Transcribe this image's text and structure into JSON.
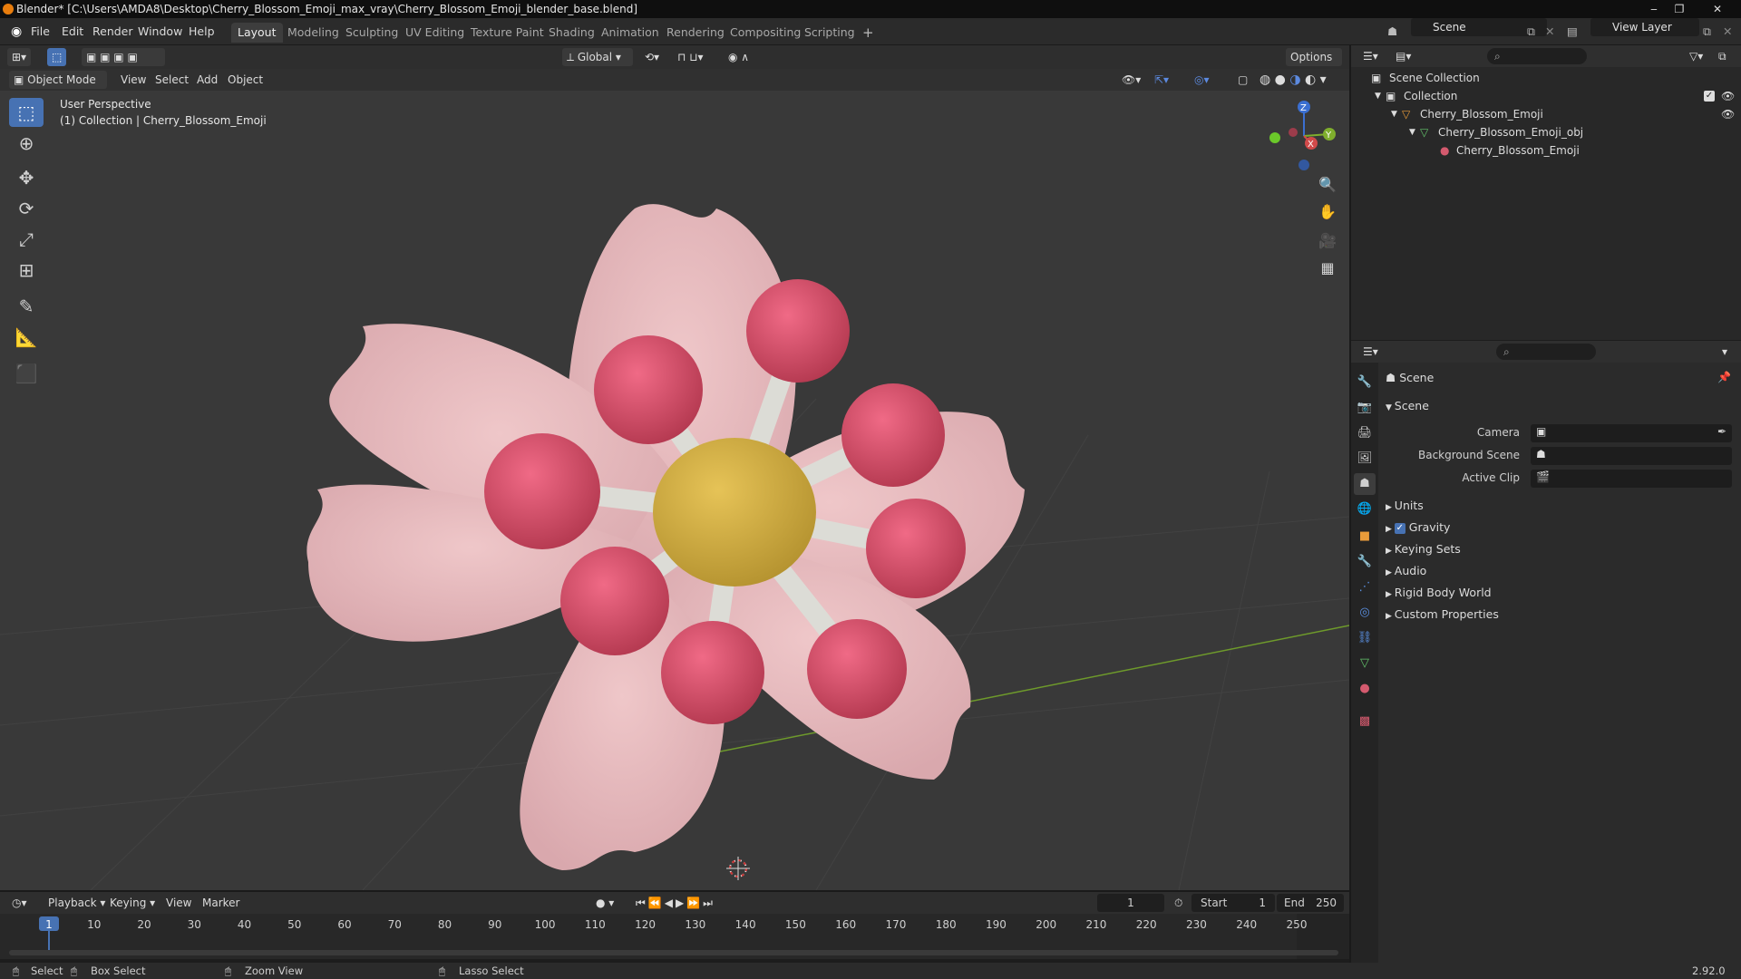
{
  "window": {
    "title": "Blender* [C:\\Users\\AMDA8\\Desktop\\Cherry_Blossom_Emoji_max_vray\\Cherry_Blossom_Emoji_blender_base.blend]",
    "minimize": "‒",
    "maximize": "❐",
    "close": "✕"
  },
  "menu": {
    "file": "File",
    "edit": "Edit",
    "render": "Render",
    "window": "Window",
    "help": "Help"
  },
  "workspaces": [
    "Layout",
    "Modeling",
    "Sculpting",
    "UV Editing",
    "Texture Paint",
    "Shading",
    "Animation",
    "Rendering",
    "Compositing",
    "Scripting"
  ],
  "topright": {
    "scene": "Scene",
    "view_layer": "View Layer"
  },
  "header": {
    "orientation": "Global",
    "options": "Options"
  },
  "viewport_menu": {
    "mode": "Object Mode",
    "view": "View",
    "select": "Select",
    "add": "Add",
    "object": "Object"
  },
  "viewport": {
    "perspective": "User Perspective",
    "collection_info": "(1) Collection | Cherry_Blossom_Emoji",
    "gizmo_x": "X",
    "gizmo_y": "Y",
    "gizmo_z": "Z",
    "colors": {
      "background": "#393939",
      "petal": "#e3b1b5",
      "stamen_tip": "#d8566e",
      "center": "#d4b347",
      "stem": "#d8d8d2"
    }
  },
  "outliner": {
    "scene_collection": "Scene Collection",
    "collection": "Collection",
    "object": "Cherry_Blossom_Emoji",
    "mesh": "Cherry_Blossom_Emoji_obj",
    "material": "Cherry_Blossom_Emoji"
  },
  "properties": {
    "context": "Scene",
    "panel": "Scene",
    "camera_label": "Camera",
    "background_scene_label": "Background Scene",
    "active_clip_label": "Active Clip",
    "sections": [
      "Units",
      "Gravity",
      "Keying Sets",
      "Audio",
      "Rigid Body World",
      "Custom Properties"
    ]
  },
  "timeline": {
    "playback": "Playback",
    "keying": "Keying",
    "view": "View",
    "marker": "Marker",
    "current_frame": "1",
    "start_label": "Start",
    "start_value": "1",
    "end_label": "End",
    "end_value": "250",
    "ticks": [
      "1",
      "10",
      "20",
      "30",
      "40",
      "50",
      "60",
      "70",
      "80",
      "90",
      "100",
      "110",
      "120",
      "130",
      "140",
      "150",
      "160",
      "170",
      "180",
      "190",
      "200",
      "210",
      "220",
      "230",
      "240",
      "250"
    ]
  },
  "status": {
    "select": "Select",
    "box_select": "Box Select",
    "zoom_view": "Zoom View",
    "lasso_select": "Lasso Select",
    "version": "2.92.0"
  }
}
